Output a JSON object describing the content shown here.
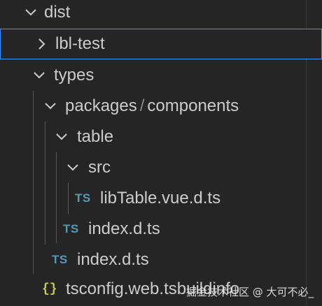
{
  "explorer": {
    "items": [
      {
        "label": "dist",
        "icon": "chevron-down-icon"
      },
      {
        "label": "lbl-test",
        "icon": "chevron-right-icon",
        "selected": true
      },
      {
        "label": "types",
        "icon": "chevron-down-icon"
      },
      {
        "label_parts": [
          "packages",
          "/",
          "components"
        ],
        "icon": "chevron-down-icon"
      },
      {
        "label": "table",
        "icon": "chevron-down-icon"
      },
      {
        "label": "src",
        "icon": "chevron-down-icon"
      },
      {
        "label": "libTable.vue.d.ts",
        "icon": "ts-file-icon",
        "badge": "TS"
      },
      {
        "label": "index.d.ts",
        "icon": "ts-file-icon",
        "badge": "TS"
      },
      {
        "label": "index.d.ts",
        "icon": "ts-file-icon",
        "badge": "TS"
      },
      {
        "label": "tsconfig.web.tsbuildinfo",
        "icon": "json-file-icon",
        "badge": "{}"
      }
    ]
  },
  "watermark": "掘金技术社区 @ 大可不必_",
  "colors": {
    "background": "#252526",
    "text": "#cccccc",
    "selection_border": "#3794ff",
    "ts_icon": "#519aba",
    "json_icon": "#cbcb41",
    "indent_guide": "#585858"
  }
}
